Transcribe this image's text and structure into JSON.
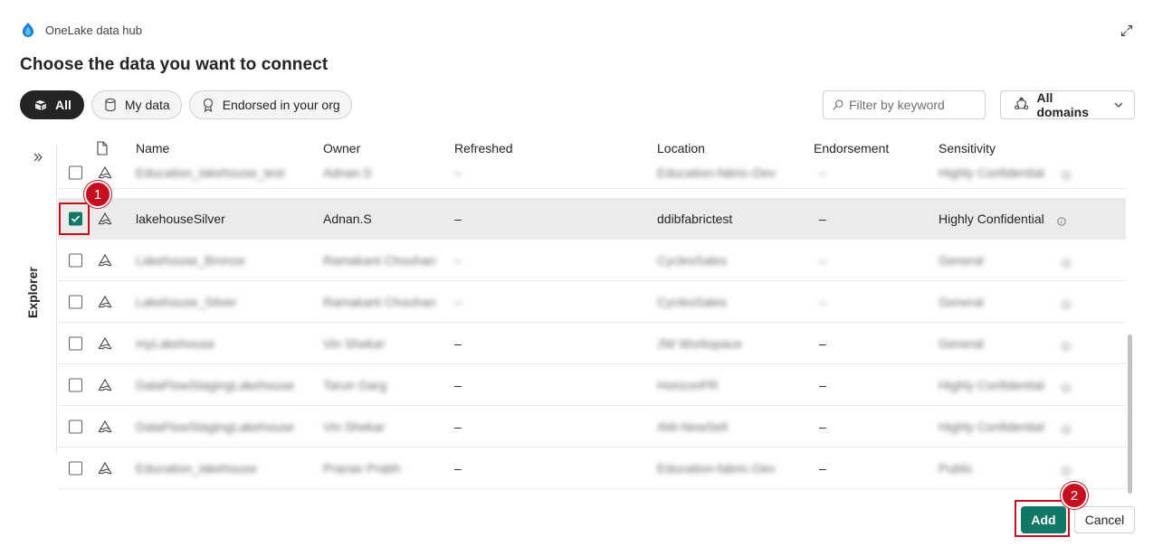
{
  "header": {
    "app_title": "OneLake data hub",
    "logo_icon": "onelake-logo-icon",
    "expand_icon": "expand-icon"
  },
  "page_title": "Choose the data you want to connect",
  "filters": {
    "pills": [
      {
        "label": "All",
        "icon": "stack-icon",
        "active": true
      },
      {
        "label": "My data",
        "icon": "database-icon",
        "active": false
      },
      {
        "label": "Endorsed in your org",
        "icon": "ribbon-icon",
        "active": false
      }
    ],
    "search_placeholder": "Filter by keyword",
    "domains_label": "All domains"
  },
  "explorer": {
    "label": "Explorer"
  },
  "table": {
    "columns": [
      "Name",
      "Owner",
      "Refreshed",
      "Location",
      "Endorsement",
      "Sensitivity"
    ],
    "rows": [
      {
        "name": "Education_lakehouse_test",
        "owner": "Adnan.S",
        "refreshed": "–",
        "location": "Education-fabric-Dev",
        "endorsement": "–",
        "sensitivity": "Highly Confidential",
        "selected": false,
        "blurred": true
      },
      {
        "name": "lakehouseSilver",
        "owner": "Adnan.S",
        "refreshed": "–",
        "location": "ddibfabrictest",
        "endorsement": "–",
        "sensitivity": "Highly Confidential",
        "selected": true,
        "blurred": false
      },
      {
        "name": "Lakehouse_Bronze",
        "owner": "Ramakant Chouhan",
        "refreshed": "–",
        "location": "CyclesSales",
        "endorsement": "–",
        "sensitivity": "General",
        "selected": false,
        "blurred": true
      },
      {
        "name": "Lakehouse_Silver",
        "owner": "Ramakant Chouhan",
        "refreshed": "–",
        "location": "CyclesSales",
        "endorsement": "–",
        "sensitivity": "General",
        "selected": false,
        "blurred": true
      },
      {
        "name": "myLakehouse",
        "owner": "Vin Shekar",
        "refreshed": "–",
        "location": "JW Workspace",
        "endorsement": "–",
        "sensitivity": "General",
        "selected": false,
        "blurred": true
      },
      {
        "name": "DataFlowStagingLakehouse",
        "owner": "Tarun Garg",
        "refreshed": "–",
        "location": "HorizonPR",
        "endorsement": "–",
        "sensitivity": "Highly Confidential",
        "selected": false,
        "blurred": true
      },
      {
        "name": "DataFlowStagingLakehouse",
        "owner": "Vin Shekar",
        "refreshed": "–",
        "location": "AW-NewSell",
        "endorsement": "–",
        "sensitivity": "Highly Confidential",
        "selected": false,
        "blurred": true
      },
      {
        "name": "Education_lakehouse",
        "owner": "Pranav Prabh",
        "refreshed": "–",
        "location": "Education-fabric-Dev",
        "endorsement": "–",
        "sensitivity": "Public",
        "selected": false,
        "blurred": true
      }
    ]
  },
  "callouts": [
    "1",
    "2"
  ],
  "actions": {
    "add_label": "Add",
    "cancel_label": "Cancel"
  },
  "colors": {
    "accent": "#117865",
    "callout": "#c50f1f",
    "selected_row": "#ebebeb"
  }
}
